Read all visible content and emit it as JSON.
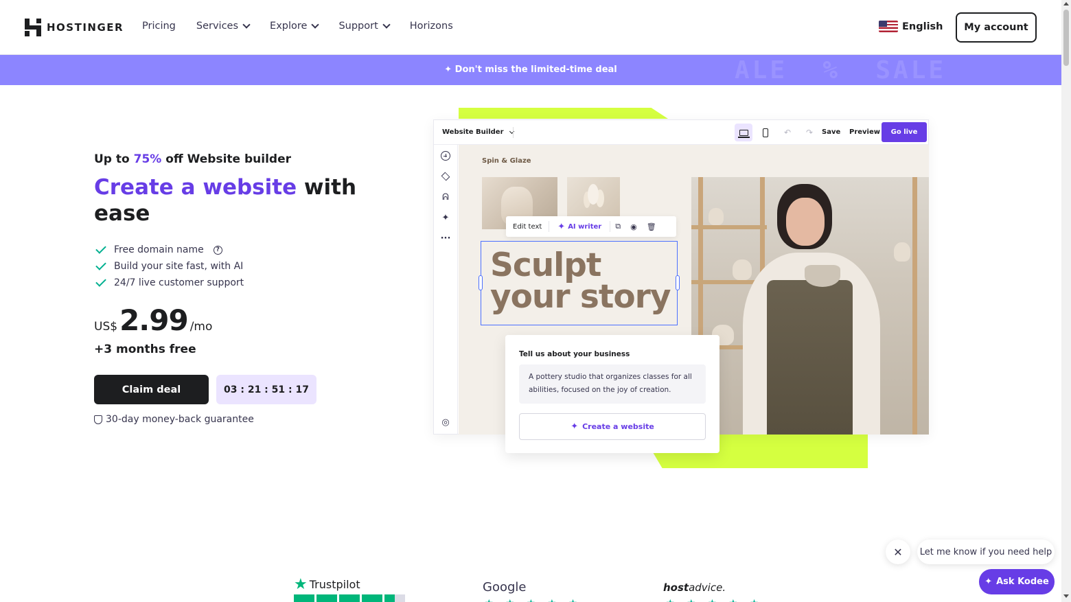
{
  "nav": {
    "brand": "HOSTINGER",
    "links": [
      {
        "label": "Pricing",
        "dropdown": false
      },
      {
        "label": "Services",
        "dropdown": true
      },
      {
        "label": "Explore",
        "dropdown": true
      },
      {
        "label": "Support",
        "dropdown": true
      },
      {
        "label": "Horizons",
        "dropdown": false
      }
    ],
    "language": "English",
    "language_flag": "us-flag-icon",
    "account": "My account"
  },
  "promo": {
    "text": "Don't miss the limited-time deal",
    "icon": "sparkle-icon",
    "background": "#8c85ff"
  },
  "hero": {
    "eyebrow_prefix": "Up to ",
    "eyebrow_highlight": "75%",
    "eyebrow_suffix": " off Website builder",
    "headline_highlight": "Create a website",
    "headline_rest": " with ease",
    "features": [
      {
        "text": "Free domain name",
        "has_help": true
      },
      {
        "text": "Build your site fast, with AI",
        "has_help": false
      },
      {
        "text": "24/7 live customer support",
        "has_help": false
      }
    ],
    "price_currency": "US$",
    "price_amount": "2.99",
    "price_period": "/mo",
    "bonus": "+3 months free",
    "cta": "Claim deal",
    "timer": "03 : 21 : 51 : 17",
    "guarantee": "30-day money-back guarantee",
    "accent_color": "#673de6"
  },
  "builder": {
    "title": "Website Builder",
    "save": "Save",
    "preview": "Preview",
    "go_live": "Go live",
    "site_name": "Spin & Glaze",
    "edit_text": "Edit text",
    "ai_writer": "AI writer",
    "headline_line1": "Sculpt",
    "headline_line2": "your story",
    "business_title": "Tell us about your business",
    "business_text": "A pottery studio that organizes classes for all abilities, focused on the joy of creation.",
    "create_button": "Create a website"
  },
  "reviews": {
    "trustpilot": "Trustpilot",
    "google": "Google",
    "hostadvice_host": "host",
    "hostadvice_advice": "advice."
  },
  "chat": {
    "message": "Let me know if you need help",
    "button": "Ask Kodee"
  }
}
